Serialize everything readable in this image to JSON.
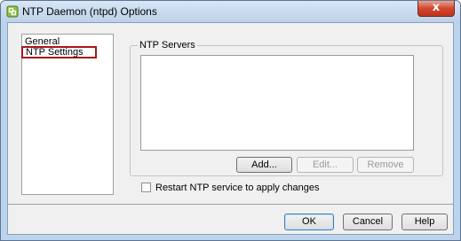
{
  "window": {
    "title": "NTP Daemon (ntpd) Options",
    "close_label": "x"
  },
  "nav": {
    "items": [
      {
        "label": "General"
      },
      {
        "label": "NTP Settings"
      }
    ]
  },
  "ntp_servers": {
    "group_label": "NTP Servers",
    "servers": [],
    "add_label": "Add...",
    "edit_label": "Edit...",
    "remove_label": "Remove"
  },
  "restart": {
    "checked": false,
    "label": "Restart NTP service to apply changes"
  },
  "footer": {
    "ok_label": "OK",
    "cancel_label": "Cancel",
    "help_label": "Help"
  },
  "colors": {
    "selection_border": "#a8171d",
    "title_bar": "#bcd3ec",
    "close_button": "#d2472e"
  }
}
